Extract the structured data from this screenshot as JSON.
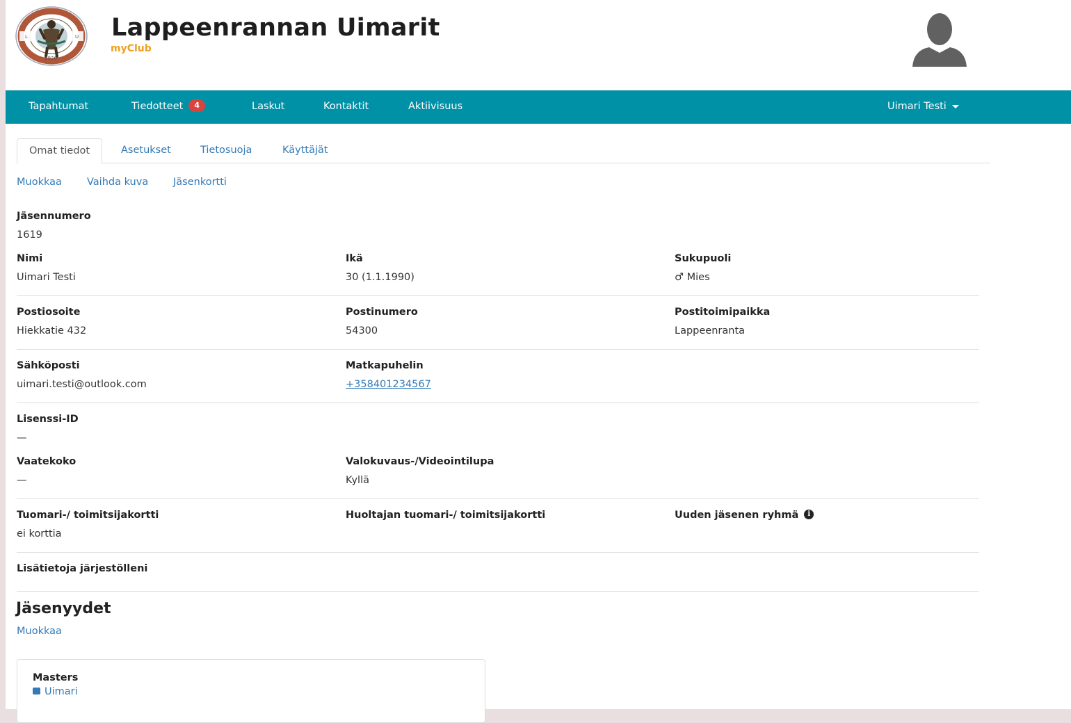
{
  "brand": {
    "title": "Lappeenrannan Uimarit",
    "subtitle": "myClub"
  },
  "colors": {
    "navbar": "#0091a7",
    "link": "#337ab7",
    "badge": "#d9443f",
    "brand_accent": "#f0a020"
  },
  "nav": {
    "items": [
      {
        "label": "Tapahtumat"
      },
      {
        "label": "Tiedotteet",
        "badge": "4"
      },
      {
        "label": "Laskut"
      },
      {
        "label": "Kontaktit"
      },
      {
        "label": "Aktiivisuus"
      }
    ],
    "user_menu": "Uimari Testi",
    "user_menu_icon": "caret-down-icon"
  },
  "tabs": [
    "Omat tiedot",
    "Asetukset",
    "Tietosuoja",
    "Käyttäjät"
  ],
  "active_tab": "Omat tiedot",
  "actions": [
    "Muokkaa",
    "Vaihda kuva",
    "Jäsenkortti"
  ],
  "profile": {
    "member_number": {
      "label": "Jäsennumero",
      "value": "1619"
    },
    "name": {
      "label": "Nimi",
      "value": "Uimari Testi"
    },
    "age": {
      "label": "Ikä",
      "value": "30 (1.1.1990)"
    },
    "gender": {
      "label": "Sukupuoli",
      "value": "♂ Mies"
    },
    "address": {
      "label": "Postiosoite",
      "value": "Hiekkatie 432"
    },
    "postal_code": {
      "label": "Postinumero",
      "value": "54300"
    },
    "city": {
      "label": "Postitoimipaikka",
      "value": "Lappeenranta"
    },
    "email": {
      "label": "Sähköposti",
      "value": "uimari.testi@outlook.com"
    },
    "phone": {
      "label": "Matkapuhelin",
      "value": "+358401234567"
    },
    "license_id": {
      "label": "Lisenssi-ID",
      "value": "—"
    },
    "clothing_size": {
      "label": "Vaatekoko",
      "value": "—"
    },
    "photo_permission": {
      "label": "Valokuvaus-/Videointilupa",
      "value": "Kyllä"
    },
    "referee_card": {
      "label": "Tuomari-/ toimitsijakortti",
      "value": "ei korttia"
    },
    "guardian_referee_card": {
      "label": "Huoltajan tuomari-/ toimitsijakortti"
    },
    "new_member_group": {
      "label": "Uuden jäsenen ryhmä",
      "icon": "info-icon"
    },
    "additional_info": {
      "label": "Lisätietoja järjestölleni"
    }
  },
  "memberships": {
    "title": "Jäsenyydet",
    "edit_label": "Muokkaa",
    "cards": [
      {
        "group": "Masters",
        "role": "Uimari"
      }
    ]
  }
}
